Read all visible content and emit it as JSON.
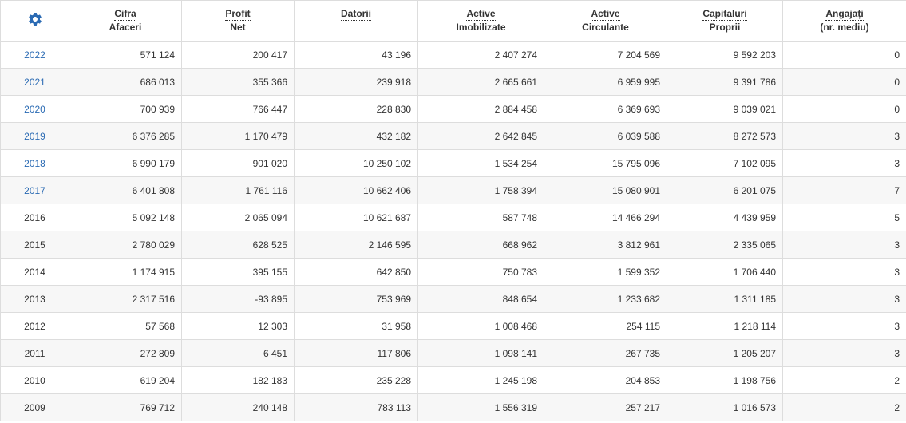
{
  "table": {
    "headers": [
      {
        "key": "cifra",
        "line1": "Cifra",
        "line2": "Afaceri"
      },
      {
        "key": "profit",
        "line1": "Profit",
        "line2": "Net"
      },
      {
        "key": "datorii",
        "line1": "Datorii",
        "line2": ""
      },
      {
        "key": "active-imob",
        "line1": "Active",
        "line2": "Imobilizate"
      },
      {
        "key": "active-circ",
        "line1": "Active",
        "line2": "Circulante"
      },
      {
        "key": "capitaluri",
        "line1": "Capitaluri",
        "line2": "Proprii"
      },
      {
        "key": "angajati",
        "line1": "Angajați",
        "line2": "(nr. mediu)"
      }
    ],
    "rows": [
      {
        "year": "2022",
        "link": true,
        "values": [
          "571 124",
          "200 417",
          "43 196",
          "2 407 274",
          "7 204 569",
          "9 592 203",
          "0"
        ]
      },
      {
        "year": "2021",
        "link": true,
        "values": [
          "686 013",
          "355 366",
          "239 918",
          "2 665 661",
          "6 959 995",
          "9 391 786",
          "0"
        ]
      },
      {
        "year": "2020",
        "link": true,
        "values": [
          "700 939",
          "766 447",
          "228 830",
          "2 884 458",
          "6 369 693",
          "9 039 021",
          "0"
        ]
      },
      {
        "year": "2019",
        "link": true,
        "values": [
          "6 376 285",
          "1 170 479",
          "432 182",
          "2 642 845",
          "6 039 588",
          "8 272 573",
          "3"
        ]
      },
      {
        "year": "2018",
        "link": true,
        "values": [
          "6 990 179",
          "901 020",
          "10 250 102",
          "1 534 254",
          "15 795 096",
          "7 102 095",
          "3"
        ]
      },
      {
        "year": "2017",
        "link": true,
        "values": [
          "6 401 808",
          "1 761 116",
          "10 662 406",
          "1 758 394",
          "15 080 901",
          "6 201 075",
          "7"
        ]
      },
      {
        "year": "2016",
        "link": false,
        "values": [
          "5 092 148",
          "2 065 094",
          "10 621 687",
          "587 748",
          "14 466 294",
          "4 439 959",
          "5"
        ]
      },
      {
        "year": "2015",
        "link": false,
        "values": [
          "2 780 029",
          "628 525",
          "2 146 595",
          "668 962",
          "3 812 961",
          "2 335 065",
          "3"
        ]
      },
      {
        "year": "2014",
        "link": false,
        "values": [
          "1 174 915",
          "395 155",
          "642 850",
          "750 783",
          "1 599 352",
          "1 706 440",
          "3"
        ]
      },
      {
        "year": "2013",
        "link": false,
        "values": [
          "2 317 516",
          "-93 895",
          "753 969",
          "848 654",
          "1 233 682",
          "1 311 185",
          "3"
        ]
      },
      {
        "year": "2012",
        "link": false,
        "values": [
          "57 568",
          "12 303",
          "31 958",
          "1 008 468",
          "254 115",
          "1 218 114",
          "3"
        ]
      },
      {
        "year": "2011",
        "link": false,
        "values": [
          "272 809",
          "6 451",
          "117 806",
          "1 098 141",
          "267 735",
          "1 205 207",
          "3"
        ]
      },
      {
        "year": "2010",
        "link": false,
        "values": [
          "619 204",
          "182 183",
          "235 228",
          "1 245 198",
          "204 853",
          "1 198 756",
          "2"
        ]
      },
      {
        "year": "2009",
        "link": false,
        "values": [
          "769 712",
          "240 148",
          "783 113",
          "1 556 319",
          "257 217",
          "1 016 573",
          "2"
        ]
      }
    ]
  },
  "icons": {
    "settings": "gear-icon"
  },
  "colors": {
    "link": "#2a6ab3",
    "gear": "#2a6ab3",
    "stripe": "#f7f7f7",
    "border": "#dddddd"
  }
}
